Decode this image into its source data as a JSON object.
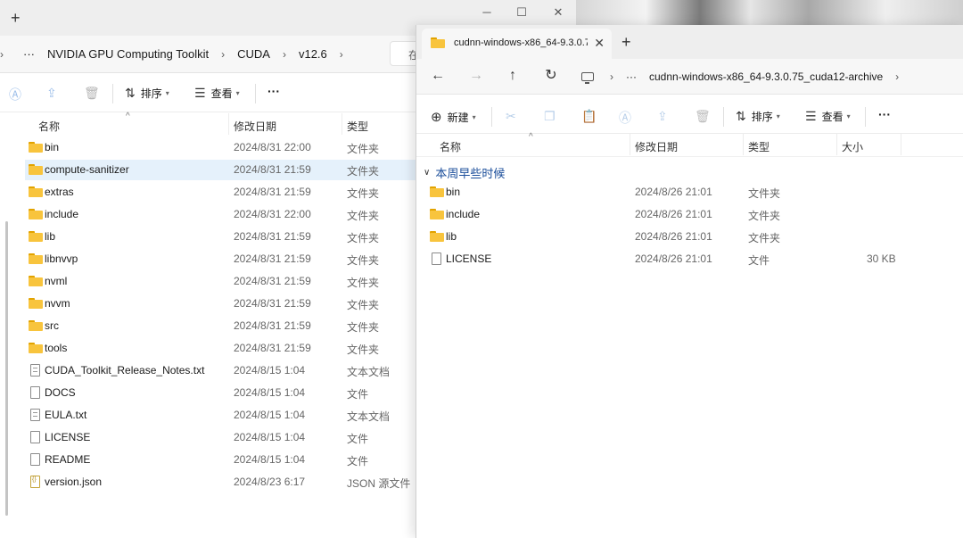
{
  "back_window": {
    "new_tab_symbol": "+",
    "window_controls": [
      "─",
      "☐",
      "✕"
    ],
    "breadcrumb": [
      "›",
      "···",
      "NVIDIA GPU Computing Toolkit",
      "›",
      "CUDA",
      "›",
      "v12.6",
      "›"
    ],
    "search_stub": "在",
    "toolbar": {
      "sort_label": "排序",
      "view_label": "查看",
      "more_label": "···"
    },
    "columns": {
      "name": "名称",
      "modified": "修改日期",
      "type": "类型"
    },
    "files": [
      {
        "name": "bin",
        "modified": "2024/8/31 22:00",
        "type": "文件夹",
        "kind": "folder"
      },
      {
        "name": "compute-sanitizer",
        "modified": "2024/8/31 21:59",
        "type": "文件夹",
        "kind": "folder",
        "selected": true
      },
      {
        "name": "extras",
        "modified": "2024/8/31 21:59",
        "type": "文件夹",
        "kind": "folder"
      },
      {
        "name": "include",
        "modified": "2024/8/31 22:00",
        "type": "文件夹",
        "kind": "folder"
      },
      {
        "name": "lib",
        "modified": "2024/8/31 21:59",
        "type": "文件夹",
        "kind": "folder"
      },
      {
        "name": "libnvvp",
        "modified": "2024/8/31 21:59",
        "type": "文件夹",
        "kind": "folder"
      },
      {
        "name": "nvml",
        "modified": "2024/8/31 21:59",
        "type": "文件夹",
        "kind": "folder"
      },
      {
        "name": "nvvm",
        "modified": "2024/8/31 21:59",
        "type": "文件夹",
        "kind": "folder"
      },
      {
        "name": "src",
        "modified": "2024/8/31 21:59",
        "type": "文件夹",
        "kind": "folder"
      },
      {
        "name": "tools",
        "modified": "2024/8/31 21:59",
        "type": "文件夹",
        "kind": "folder"
      },
      {
        "name": "CUDA_Toolkit_Release_Notes.txt",
        "modified": "2024/8/15 1:04",
        "type": "文本文档",
        "kind": "txt"
      },
      {
        "name": "DOCS",
        "modified": "2024/8/15 1:04",
        "type": "文件",
        "kind": "file"
      },
      {
        "name": "EULA.txt",
        "modified": "2024/8/15 1:04",
        "type": "文本文档",
        "kind": "txt"
      },
      {
        "name": "LICENSE",
        "modified": "2024/8/15 1:04",
        "type": "文件",
        "kind": "file"
      },
      {
        "name": "README",
        "modified": "2024/8/15 1:04",
        "type": "文件",
        "kind": "file"
      },
      {
        "name": "version.json",
        "modified": "2024/8/23 6:17",
        "type": "JSON 源文件",
        "kind": "json"
      }
    ]
  },
  "front_window": {
    "tab_title": "cudnn-windows-x86_64-9.3.0.7",
    "tab_close": "✕",
    "new_tab_symbol": "+",
    "nav": {
      "back": "←",
      "forward": "→",
      "up": "↑",
      "refresh": "↻"
    },
    "breadcrumb": [
      "›",
      "···",
      "cudnn-windows-x86_64-9.3.0.75_cuda12-archive",
      "›"
    ],
    "toolbar": {
      "new_label": "新建",
      "sort_label": "排序",
      "view_label": "查看",
      "more_label": "···"
    },
    "columns": {
      "name": "名称",
      "modified": "修改日期",
      "type": "类型",
      "size": "大小"
    },
    "group_label": "本周早些时候",
    "files": [
      {
        "name": "bin",
        "modified": "2024/8/26 21:01",
        "type": "文件夹",
        "size": "",
        "kind": "folder"
      },
      {
        "name": "include",
        "modified": "2024/8/26 21:01",
        "type": "文件夹",
        "size": "",
        "kind": "folder"
      },
      {
        "name": "lib",
        "modified": "2024/8/26 21:01",
        "type": "文件夹",
        "size": "",
        "kind": "folder"
      },
      {
        "name": "LICENSE",
        "modified": "2024/8/26 21:01",
        "type": "文件",
        "size": "30 KB",
        "kind": "file"
      }
    ]
  }
}
